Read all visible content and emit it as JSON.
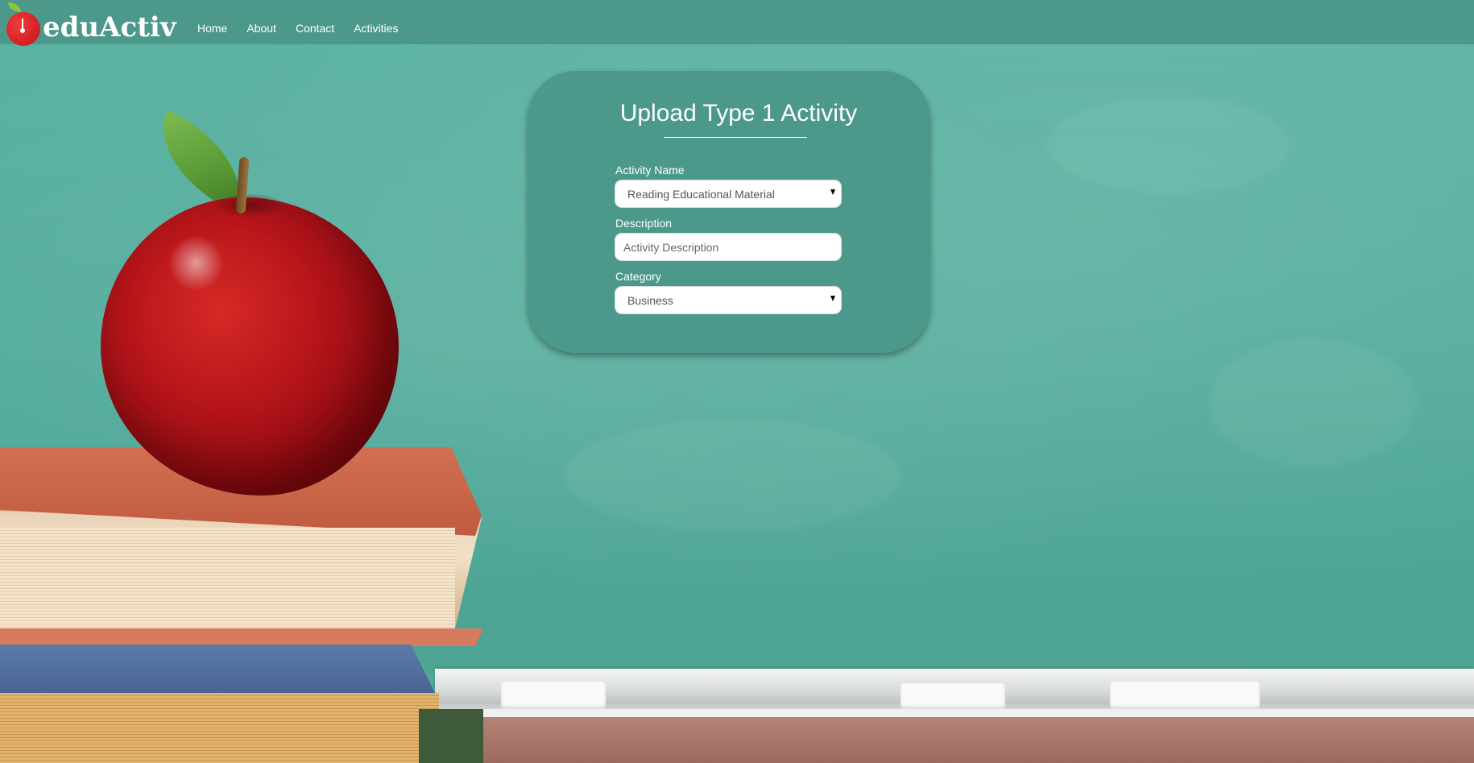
{
  "nav": {
    "logo_text": "eduActiv",
    "links": [
      "Home",
      "About",
      "Contact",
      "Activities"
    ]
  },
  "panel": {
    "title": "Upload Type 1 Activity",
    "activity_name": {
      "label": "Activity Name",
      "value": "Reading Educational Material"
    },
    "description": {
      "label": "Description",
      "placeholder": "Activity Description"
    },
    "category": {
      "label": "Category",
      "value": "Business"
    }
  },
  "colors": {
    "nav_bg": "#4c998b",
    "panel_bg": "#4c998b",
    "accent_apple": "#d41e23",
    "text": "#ffffff"
  },
  "icons": {
    "logo": "apple-logo-icon",
    "dropdown": "caret-down-icon"
  }
}
